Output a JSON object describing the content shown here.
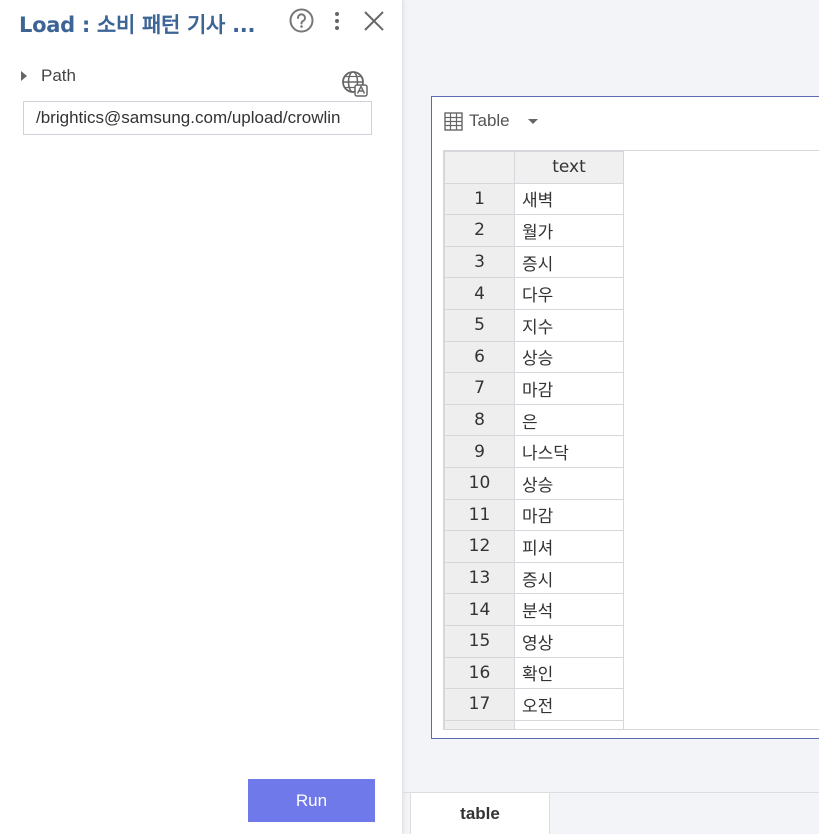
{
  "panel": {
    "title": "Load : 소비 패턴 기사 ...",
    "path_label": "Path",
    "path_value": "/brightics@samsung.com/upload/crowlin",
    "run_label": "Run",
    "icons": [
      "help-icon",
      "more-icon",
      "close-icon",
      "globe-icon",
      "caret-right-icon"
    ]
  },
  "result": {
    "selector_label": "Table",
    "table": {
      "columns": [
        "text"
      ],
      "rows": [
        {
          "n": "1",
          "text": "새벽"
        },
        {
          "n": "2",
          "text": "월가"
        },
        {
          "n": "3",
          "text": "증시"
        },
        {
          "n": "4",
          "text": "다우"
        },
        {
          "n": "5",
          "text": "지수"
        },
        {
          "n": "6",
          "text": "상승"
        },
        {
          "n": "7",
          "text": "마감"
        },
        {
          "n": "8",
          "text": "은"
        },
        {
          "n": "9",
          "text": "나스닥"
        },
        {
          "n": "10",
          "text": "상승"
        },
        {
          "n": "11",
          "text": "마감"
        },
        {
          "n": "12",
          "text": "피셔"
        },
        {
          "n": "13",
          "text": "증시"
        },
        {
          "n": "14",
          "text": "분석"
        },
        {
          "n": "15",
          "text": "영상"
        },
        {
          "n": "16",
          "text": "확인"
        },
        {
          "n": "17",
          "text": "오전"
        },
        {
          "n": "",
          "text": ""
        }
      ]
    }
  },
  "tabs": [
    {
      "label": "table"
    }
  ],
  "colors": {
    "accent": "#6f79ea",
    "title": "#3c6596",
    "border": "#5e69b8"
  }
}
